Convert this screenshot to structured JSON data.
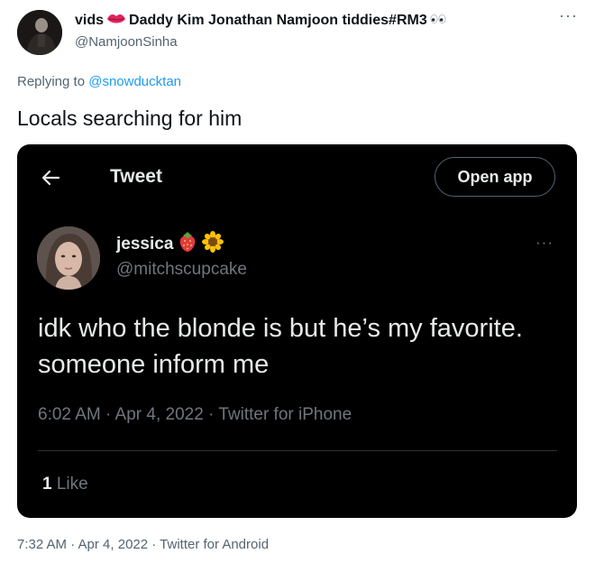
{
  "tweet": {
    "name_start": "vids",
    "name_rest": "Daddy Kim Jonathan Namjoon tiddies#RM3",
    "handle": "@NamjoonSinha",
    "more_icon": "more-icon",
    "reply_prefix": "Replying to",
    "reply_mention": "@snowducktan",
    "text": "Locals searching for him",
    "meta": "7:32 AM · Apr 4, 2022 · Twitter for Android",
    "emoji_icons": [
      "kiss-lips-icon",
      "eyes-icon"
    ]
  },
  "quoted_screenshot": {
    "header_title": "Tweet",
    "open_app_label": "Open app",
    "back_icon": "back-arrow-icon",
    "name": "jessica",
    "name_emoji_icons": [
      "strawberry-icon",
      "sunflower-icon"
    ],
    "handle": "@mitchscupcake",
    "text": "idk who the blonde is but he’s my favorite. someone inform me",
    "meta": "6:02 AM · Apr 4, 2022 · Twitter for iPhone",
    "likes_count": "1",
    "likes_label": "Like"
  },
  "colors": {
    "accent": "#1d9bf0",
    "secondary_text": "#536471",
    "dark_bg": "#000000",
    "dark_text": "#e7e9ea",
    "dark_secondary": "#71767b"
  }
}
